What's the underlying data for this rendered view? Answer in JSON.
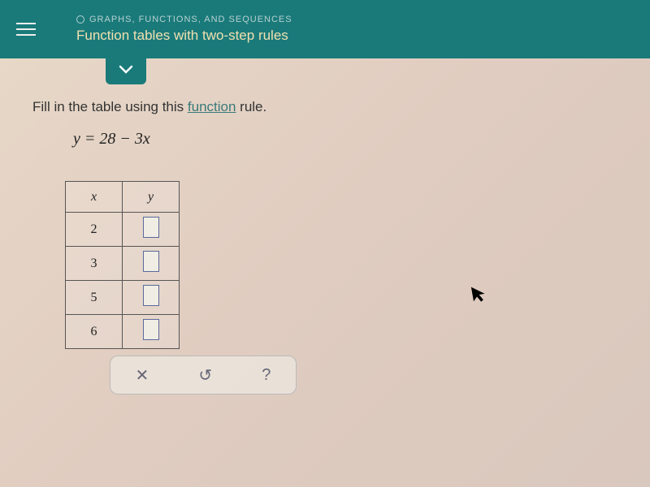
{
  "header": {
    "breadcrumb": "GRAPHS, FUNCTIONS, AND SEQUENCES",
    "title": "Function tables with two-step rules"
  },
  "instruction": {
    "prefix": "Fill in the table using this ",
    "link_text": "function",
    "suffix": " rule."
  },
  "equation": "y = 28 − 3x",
  "table": {
    "col_x": "x",
    "col_y": "y",
    "rows": [
      {
        "x": "2",
        "y": ""
      },
      {
        "x": "3",
        "y": ""
      },
      {
        "x": "5",
        "y": ""
      },
      {
        "x": "6",
        "y": ""
      }
    ]
  },
  "toolbar": {
    "clear": "✕",
    "reset": "↺",
    "help": "?"
  }
}
